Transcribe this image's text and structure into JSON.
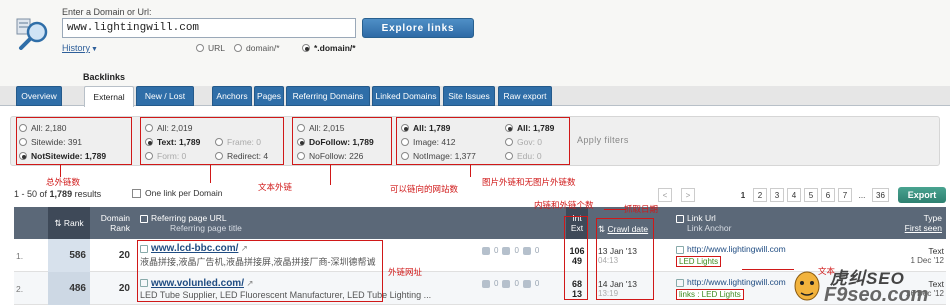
{
  "search": {
    "label": "Enter a Domain or Url:",
    "value": "www.lightingwill.com",
    "button": "Explore links",
    "history": "History",
    "history_caret": "▼",
    "options": [
      {
        "label": "URL",
        "selected": false
      },
      {
        "label": "domain/*",
        "selected": false
      },
      {
        "label": "*.domain/*",
        "selected": true
      }
    ]
  },
  "section_title": "Backlinks",
  "tabs": [
    {
      "label": "Overview",
      "active": false
    },
    {
      "label": "External",
      "active": true
    },
    {
      "label": "New / Lost",
      "active": false
    },
    {
      "label": "Anchors",
      "active": false
    },
    {
      "label": "Pages",
      "active": false
    },
    {
      "label": "Referring Domains",
      "active": false
    },
    {
      "label": "Linked Domains",
      "active": false
    },
    {
      "label": "Site Issues",
      "active": false
    },
    {
      "label": "Raw export",
      "active": false
    }
  ],
  "filters": {
    "col1": [
      "All: 2,180",
      "Sitewide: 391",
      "NotSitewide: 1,789"
    ],
    "col2a": [
      "All: 2,019",
      "Text: 1,789",
      "Form: 0"
    ],
    "col2b": [
      "Frame: 0",
      "Redirect: 4"
    ],
    "col3": [
      "All: 2,015",
      "DoFollow: 1,789",
      "NoFollow: 226"
    ],
    "col4": [
      "All: 1,789",
      "Image: 412",
      "NotImage: 1,377"
    ],
    "col5": [
      "All: 1,789",
      "Gov: 0",
      "Edu: 0"
    ],
    "apply": "Apply filters"
  },
  "annotations": {
    "total": "总外链数",
    "text": "文本外链",
    "dofollow": "可以链向的网站数",
    "image": "图片外链和无图片外链数",
    "intext": "内链和外链个数",
    "crawl": "抓取日期",
    "url": "外链网址",
    "anchor": "文本"
  },
  "results": {
    "prefix": "1 - 50 of",
    "count": "1,789",
    "suffix": "results",
    "one_link": "One link per Domain"
  },
  "pager": {
    "prev": "<",
    "next": ">",
    "pages": [
      "1",
      "2",
      "3",
      "4",
      "5",
      "6",
      "7"
    ],
    "ellipsis": "...",
    "last": "36",
    "current": "1"
  },
  "export": "Export",
  "columns": {
    "rank": "Rank",
    "rank_prefix": "⇅",
    "domain_rank_1": "Domain",
    "domain_rank_2": "Rank",
    "ref_url": "Referring page URL",
    "ref_title": "Referring page title",
    "int": "Int",
    "ext": "Ext",
    "crawl": "Crawl date",
    "link_url": "Link Url",
    "link_anchor": "Link Anchor",
    "type": "Type",
    "first_seen": "First seen"
  },
  "rows": [
    {
      "index": "1.",
      "rank": "586",
      "domain_rank": "20",
      "url": "www.lcd-bbc.com/",
      "title": "液晶拼接,液晶广告机,液晶拼接屏,液晶拼接厂商-深圳德帮诚",
      "int": "106",
      "ext": "49",
      "crawl_date": "13 Jan '13",
      "crawl_time": "04:13",
      "link_url": "http://www.lightingwill.com",
      "anchor": "LED Lights",
      "type": "Text",
      "first_seen": "1 Dec '12"
    },
    {
      "index": "2.",
      "rank": "486",
      "domain_rank": "20",
      "url": "www.volunled.com/",
      "title": "LED Tube Supplier, LED Fluorescent Manufacturer, LED Tube Lighting ...",
      "int": "68",
      "ext": "13",
      "crawl_date": "14 Jan '13",
      "crawl_time": "13:19",
      "link_url": "http://www.lightingwill.com",
      "anchor": "links : LED Lights",
      "type": "Text",
      "first_seen": "26 Dec '12"
    }
  ],
  "watermark": {
    "line1": "虎纠SEO",
    "line2": "F9seo.com"
  }
}
